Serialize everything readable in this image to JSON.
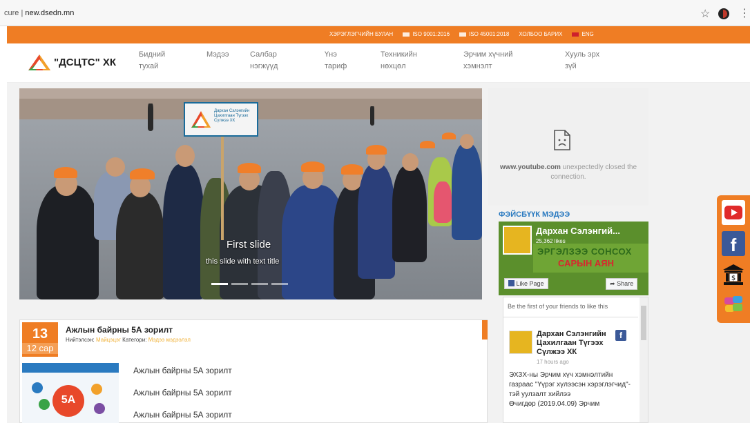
{
  "browser": {
    "url_prefix": "cure",
    "url": "new.dsedn.mn"
  },
  "topbar": {
    "links": [
      "ХЭРЭГЛЭГЧИЙН БУЛАН",
      "ISO 9001:2016",
      "ISO 45001:2018",
      "ХОЛБОО БАРИХ",
      "ENG"
    ]
  },
  "logo": {
    "title": "\"ДСЦТС\" ХК"
  },
  "nav": {
    "items": [
      {
        "line1": "Бидний",
        "line2": "тухай"
      },
      {
        "line1": "Мэдээ",
        "line2": ""
      },
      {
        "line1": "Салбар",
        "line2": "нэгжүүд"
      },
      {
        "line1": "Үнэ",
        "line2": "тариф"
      },
      {
        "line1": "Техникийн",
        "line2": "нөхцөл"
      },
      {
        "line1": "Эрчим хүчний",
        "line2": "хэмнэлт"
      },
      {
        "line1": "Хууль эрх",
        "line2": "зүй"
      }
    ]
  },
  "slider": {
    "sign_text": "Дархан Сэлэнгийн Цахилгаан Түгээх Сүлжээ ХК",
    "caption": "First slide",
    "subcaption": "this slide with text title",
    "indicator_count": 4,
    "active_indicator": 0
  },
  "youtube": {
    "domain": "www.youtube.com",
    "message": "unexpectedly closed the connection."
  },
  "facebook": {
    "heading": "ФЭЙСБҮҮК МЭДЭЭ",
    "page_name": "Дархан Сэлэнгий...",
    "likes": "25,362 likes",
    "cover_line1": "ЭРГЭЛЗЭЭ СОНСОХ",
    "cover_line2": "САРЫН АЯН",
    "like_button": "Like Page",
    "share_button": "Share",
    "friends_text": "Be the first of your friends to like this",
    "post": {
      "author": "Дархан Сэлэнгийн Цахилгаан Түгээх Сүлжээ ХК",
      "time": "17 hours ago",
      "body": "ЭХЗХ-ны Эрчим хүч хэмнэлтийн газраас \"Үүрэг хүлээсэн хэрэглэгчид\"-тэй уулзалт хийлээ",
      "body2": "Өчигдөр (2019.04.09) Эрчим"
    }
  },
  "news": {
    "day": "13",
    "month": "12 сар",
    "title": "Ажлын байрны 5А зорилт",
    "meta_label": "Нийтэлсэн:",
    "author": "Майцэцэг",
    "category_label": "Категори:",
    "category": "Мэдээ мэдээлэл",
    "image_label": "5A",
    "lines": [
      "Ажлын байрны 5А зорилт",
      "Ажлын байрны 5А зорилт",
      "Ажлын байрны 5А зорилт"
    ]
  },
  "colors": {
    "brand_orange": "#ef7d24",
    "facebook_blue": "#3b5998",
    "youtube_red": "#e02a2a"
  }
}
